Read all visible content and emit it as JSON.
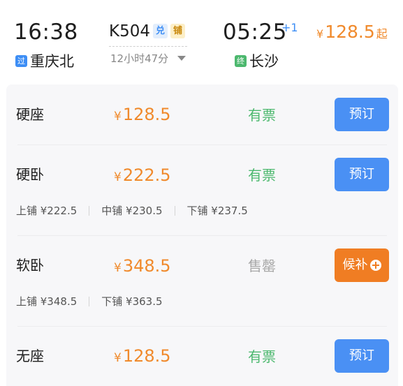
{
  "header": {
    "departure_time": "16:38",
    "departure_tag": "过",
    "departure_station": "重庆北",
    "train_number": "K504",
    "badges": [
      "兑",
      "铺"
    ],
    "duration": "12小时47分",
    "arrival_time": "05:25",
    "arrival_day_offset": "+1",
    "arrival_tag": "终",
    "arrival_station": "长沙",
    "min_price": {
      "currency": "¥",
      "amount": "128.5",
      "suffix": "起"
    }
  },
  "seats": [
    {
      "name": "硬座",
      "currency": "¥",
      "price": "128.5",
      "status": "有票",
      "action": "预订",
      "sub_prices": []
    },
    {
      "name": "硬卧",
      "currency": "¥",
      "price": "222.5",
      "status": "有票",
      "action": "预订",
      "sub_prices": [
        "上铺 ¥222.5",
        "中铺 ¥230.5",
        "下铺 ¥237.5"
      ]
    },
    {
      "name": "软卧",
      "currency": "¥",
      "price": "348.5",
      "status": "售罄",
      "action": "候补",
      "sub_prices": [
        "上铺 ¥348.5",
        "下铺 ¥363.5"
      ]
    },
    {
      "name": "无座",
      "currency": "¥",
      "price": "128.5",
      "status": "有票",
      "action": "预订",
      "sub_prices": []
    }
  ],
  "colors": {
    "accent_blue": "#4a90f4",
    "price_orange": "#f08a2c",
    "available_green": "#4cb86e",
    "soldout_gray": "#a8a8a8",
    "waitlist_orange": "#f07d23"
  },
  "icons": {
    "waitlist_icon": "plus-circle-icon",
    "duration_toggle": "caret-down-icon"
  }
}
